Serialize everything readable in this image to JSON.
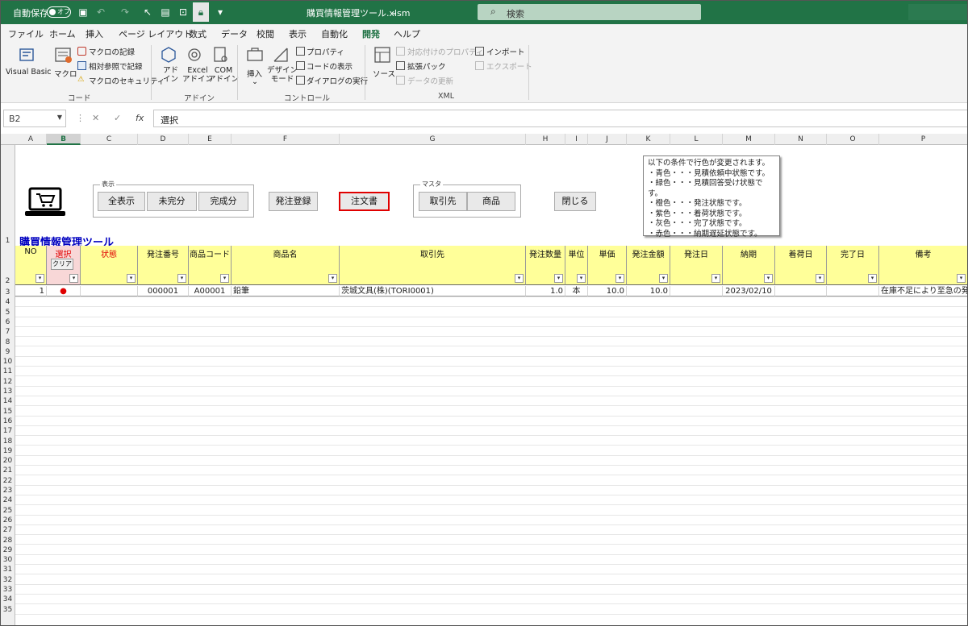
{
  "titlebar": {
    "autosave_label": "自動保存",
    "autosave_state": "オフ",
    "filename": "購買情報管理ツール.xlsm",
    "search_placeholder": "検索"
  },
  "ribbon_tabs": [
    "ファイル",
    "ホーム",
    "挿入",
    "ページ レイアウト",
    "数式",
    "データ",
    "校閲",
    "表示",
    "自動化",
    "開発",
    "ヘルプ"
  ],
  "active_tab": "開発",
  "ribbon": {
    "code": {
      "label": "コード",
      "visual_basic": "Visual Basic",
      "macro": "マクロ",
      "record_macro": "マクロの記録",
      "relative_ref": "相対参照で記録",
      "macro_security": "マクロのセキュリティ"
    },
    "addins": {
      "label": "アドイン",
      "addin": "アド\nイン",
      "excel_addin": "Excel\nアドイン",
      "com_addin": "COM\nアドイン"
    },
    "controls": {
      "label": "コントロール",
      "insert": "挿入",
      "design_mode": "デザイン\nモード",
      "properties": "プロパティ",
      "view_code": "コードの表示",
      "run_dialog": "ダイアログの実行"
    },
    "xml": {
      "label": "XML",
      "source": "ソース",
      "map_properties": "対応付けのプロパティ",
      "expansion_packs": "拡張パック",
      "refresh_data": "データの更新",
      "import": "インポート",
      "export": "エクスポート"
    }
  },
  "formula_bar": {
    "name_box": "B2",
    "cancel": "✕",
    "enter": "✓",
    "fx": "fx",
    "content": "選択"
  },
  "columns": [
    "A",
    "B",
    "C",
    "D",
    "E",
    "F",
    "G",
    "H",
    "I",
    "J",
    "K",
    "L",
    "M",
    "N",
    "O",
    "P"
  ],
  "selected_column": "B",
  "rows": [
    "1",
    "2",
    "3",
    "4",
    "5",
    "6",
    "7",
    "8",
    "9",
    "10",
    "11",
    "12",
    "13",
    "14",
    "15",
    "16",
    "17",
    "18",
    "19",
    "20",
    "21",
    "22",
    "23",
    "24",
    "25",
    "26",
    "27",
    "28",
    "29",
    "30",
    "31",
    "32",
    "33",
    "34",
    "35"
  ],
  "sheet": {
    "title": "購買情報管理ツール",
    "display_group_label": "表示",
    "show_all": "全表示",
    "incomplete": "未完分",
    "complete": "完成分",
    "order_register": "発注登録",
    "purchase_order": "注文書",
    "master_group_label": "マスタ",
    "suppliers": "取引先",
    "products": "商品",
    "close": "閉じる",
    "clear_button": "クリア",
    "note_lines": [
      "以下の条件で行色が変更されます。",
      "・青色・・・見積依頼中状態です。",
      "・緑色・・・見積回答受け状態です。",
      "・橙色・・・発注状態です。",
      "・紫色・・・着荷状態です。",
      "・灰色・・・完了状態です。",
      "・赤色・・・納期遅延状態です。"
    ]
  },
  "table": {
    "headers": [
      "NO",
      "選択",
      "状態",
      "発注番号",
      "商品コード",
      "商品名",
      "取引先",
      "発注数量",
      "単位",
      "単価",
      "発注金額",
      "発注日",
      "納期",
      "着荷日",
      "完了日",
      "備考"
    ],
    "row": {
      "no": "1",
      "selected": "●",
      "status": "",
      "order_no": "000001",
      "product_code": "A00001",
      "product_name": "鉛筆",
      "supplier": "茨城文具(株)(TORI0001)",
      "quantity": "1.0",
      "unit": "本",
      "unit_price": "10.0",
      "amount": "10.0",
      "order_date": "",
      "due_date": "2023/02/10",
      "arrival_date": "",
      "completion_date": "",
      "remarks": "在庫不足により至急の発注"
    }
  },
  "colors": {
    "excel_green": "#217346",
    "header_fill": "#ffff99",
    "selected_header_fill": "#f8d7d7",
    "title_blue": "#0000c0",
    "highlight_red": "#e00000"
  }
}
